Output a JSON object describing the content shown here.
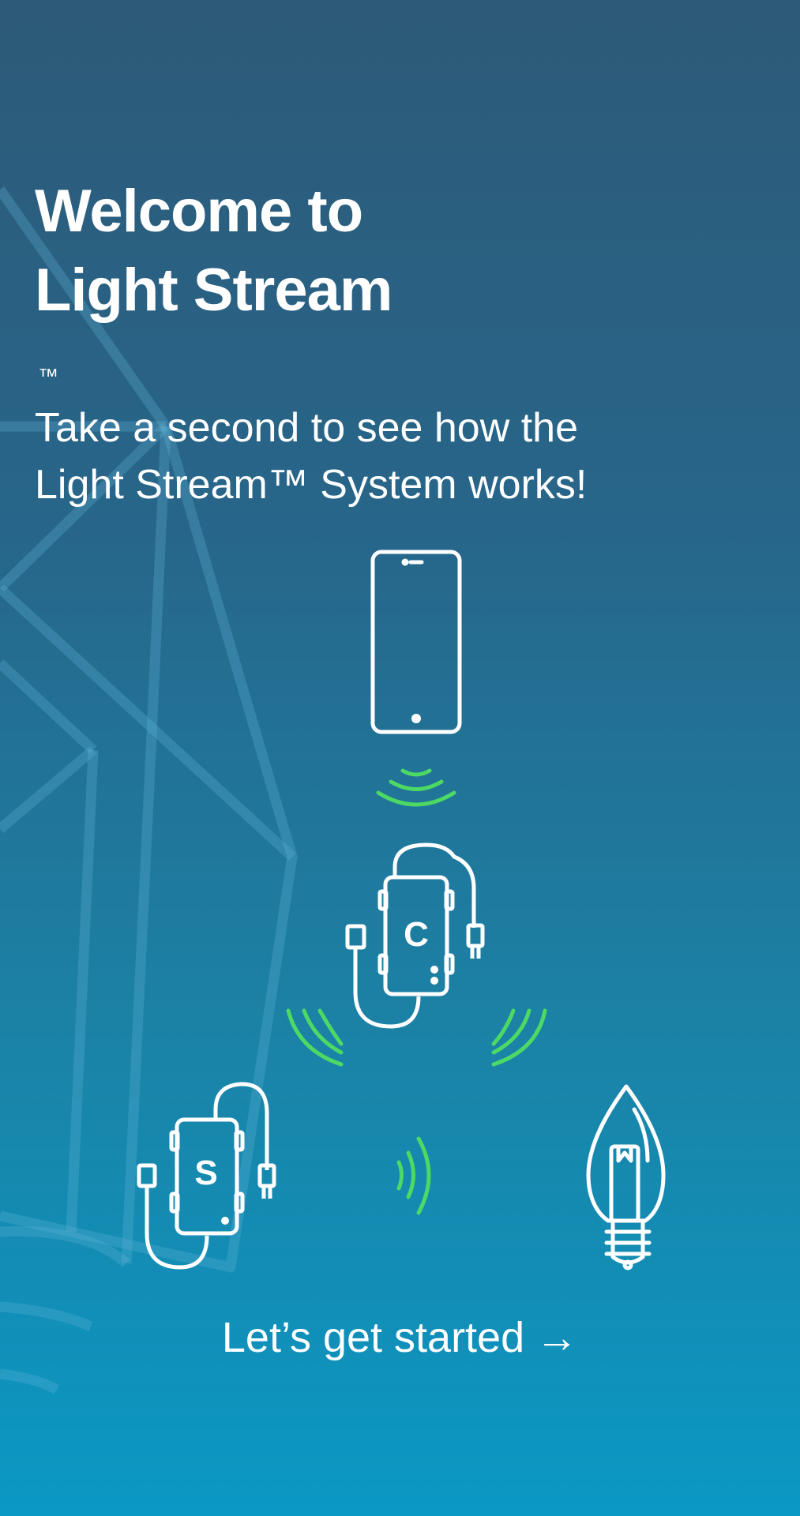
{
  "welcome": {
    "title_line1": "Welcome to",
    "title_line2": "Light Stream",
    "trademark": "™",
    "subtitle_line1": "Take a second to see how the",
    "subtitle_line2": "Light Stream™ System works!"
  },
  "illustration": {
    "controller_letter": "C",
    "satellite_letter": "S",
    "icons": [
      "smartphone-icon",
      "controller-device-icon",
      "satellite-device-icon",
      "bulb-icon",
      "wireless-signal-icon"
    ],
    "colors": {
      "line": "#ffffff",
      "signal": "#4cd964"
    }
  },
  "cta": {
    "label": "Let’s get started",
    "arrow": "→"
  }
}
